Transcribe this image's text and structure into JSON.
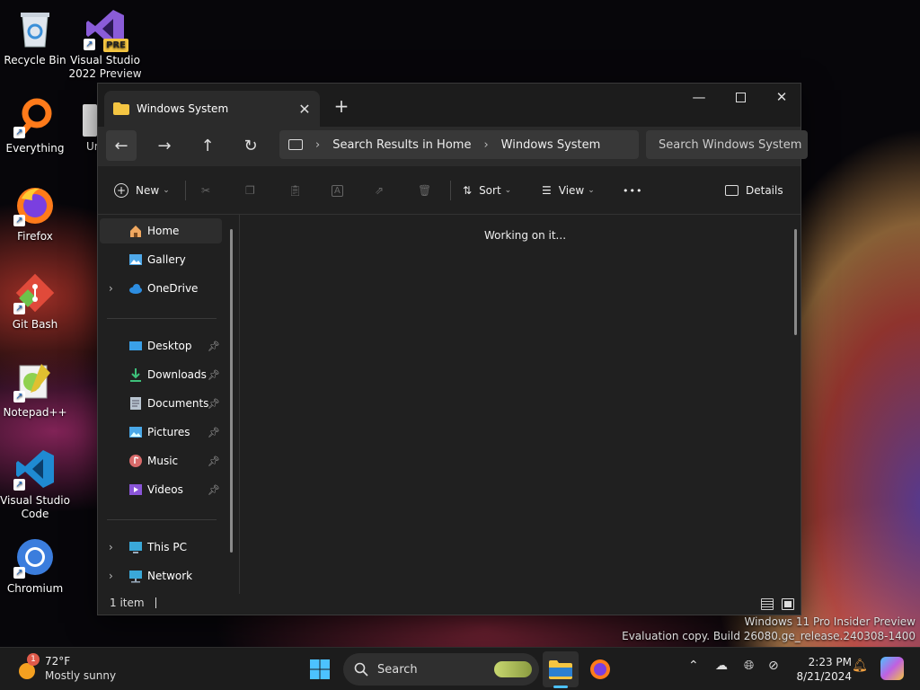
{
  "desktop": {
    "icons": [
      {
        "label": "Recycle Bin"
      },
      {
        "label": "Visual Studio 2022 Preview",
        "badge": "PRE"
      },
      {
        "label": "Everything"
      },
      {
        "label": "Ur"
      },
      {
        "label": "Firefox"
      },
      {
        "label": "Git Bash"
      },
      {
        "label": "Notepad++"
      },
      {
        "label": "Visual Studio Code"
      },
      {
        "label": "Chromium"
      }
    ]
  },
  "window": {
    "tab_title": "Windows System",
    "new_tab_glyph": "+",
    "breadcrumb": [
      "Search Results in Home",
      "Windows System"
    ],
    "search_placeholder": "Search Windows System",
    "commands": {
      "new": "New",
      "sort": "Sort",
      "view": "View",
      "more": "•••",
      "details": "Details"
    },
    "sidebar": {
      "quick": [
        {
          "label": "Home",
          "icon": "home-icon"
        },
        {
          "label": "Gallery",
          "icon": "gallery-icon"
        },
        {
          "label": "OneDrive",
          "icon": "cloud-icon"
        }
      ],
      "pinned": [
        {
          "label": "Desktop",
          "icon": "desktop-folder-icon"
        },
        {
          "label": "Downloads",
          "icon": "download-icon"
        },
        {
          "label": "Documents",
          "icon": "document-icon"
        },
        {
          "label": "Pictures",
          "icon": "picture-icon"
        },
        {
          "label": "Music",
          "icon": "music-icon"
        },
        {
          "label": "Videos",
          "icon": "video-icon"
        }
      ],
      "devices": [
        {
          "label": "This PC",
          "icon": "computer-icon"
        },
        {
          "label": "Network",
          "icon": "network-icon"
        }
      ]
    },
    "content_message": "Working on it...",
    "status_text": "1 item"
  },
  "watermark": {
    "line1": "Windows 11 Pro Insider Preview",
    "line2": "Evaluation copy. Build 26080.ge_release.240308-1400"
  },
  "taskbar": {
    "weather_temp": "72°F",
    "weather_desc": "Mostly sunny",
    "weather_badge": "1",
    "search_label": "Search",
    "time": "2:23 PM",
    "date": "8/21/2024"
  },
  "colors": {
    "accent": "#4cc2ff",
    "folder": "#f4c542",
    "window_bg": "#202020"
  }
}
